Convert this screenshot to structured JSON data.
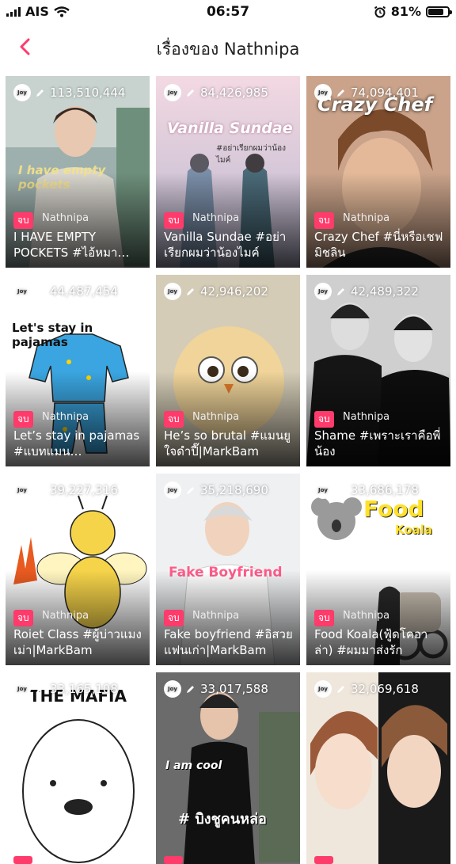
{
  "status": {
    "carrier": "AIS",
    "time": "06:57",
    "battery": "81%",
    "battery_level": 0.81
  },
  "header": {
    "title": "เรื่องของ Nathnipa"
  },
  "badge_label": "จบ",
  "cards": [
    {
      "views": "113,510,444",
      "author": "Nathnipa",
      "title": "I HAVE EMPTY POCKETS #ไอ้หมา…",
      "cover_text": "I have empty pockets",
      "bg": "#8aa0a0"
    },
    {
      "views": "84,426,985",
      "author": "Nathnipa",
      "title": "Vanilla Sundae #อย่าเรียกผมว่าน้องไมค์",
      "cover_text": "Vanilla Sundae",
      "cover_sub": "#อย่าเรียกผมว่าน้องไมค์",
      "bg": "#d8b5c7"
    },
    {
      "views": "74,094,401",
      "author": "Nathnipa",
      "title": "Crazy Chef #นี่หรือเชฟมิชลิน",
      "cover_text": "Crazy Chef",
      "bg": "#a36a45"
    },
    {
      "views": "44,487,454",
      "author": "Nathnipa",
      "title": "Let’s stay in pajamas #แบทแมน…",
      "cover_text": "Let's stay in pajamas",
      "bg": "#ffffff"
    },
    {
      "views": "42,946,202",
      "author": "Nathnipa",
      "title": "He’s so brutal #แมนยูใจดำปี๊|MarkBam",
      "bg": "#c9c2ad"
    },
    {
      "views": "42,489,322",
      "author": "Nathnipa",
      "title": "Shame #เพราะเราคือพี่น้อง",
      "bg": "#3a3a3a"
    },
    {
      "views": "39,227,316",
      "author": "Nathnipa",
      "title": "Roiet Class #ผู้บ่าวแมงเม่า|MarkBam",
      "bg": "#ffffff"
    },
    {
      "views": "35,218,690",
      "author": "Nathnipa",
      "title": "Fake boyfriend #อิสวยแฟนเก่า|MarkBam",
      "cover_text": "Fake Boyfriend",
      "bg": "#eef0f2"
    },
    {
      "views": "33,686,178",
      "author": "Nathnipa",
      "title": "Food Koala(ฟู้ดโคอาล่า) #ผมมาส่งรัก",
      "cover_text": "Food",
      "cover_sub": "Koala",
      "bg": "#ffffff"
    },
    {
      "views": "33,165,108",
      "author": "",
      "title": "",
      "cover_text": "THE MAFIA",
      "bg": "#ffffff"
    },
    {
      "views": "33,017,588",
      "author": "",
      "title": "",
      "cover_text": "I am cool",
      "cover_sub": "# บิงชูคนหล่อ",
      "bg": "#707070"
    },
    {
      "views": "32,069,618",
      "author": "",
      "title": "",
      "bg": "#e8ddd4"
    }
  ]
}
